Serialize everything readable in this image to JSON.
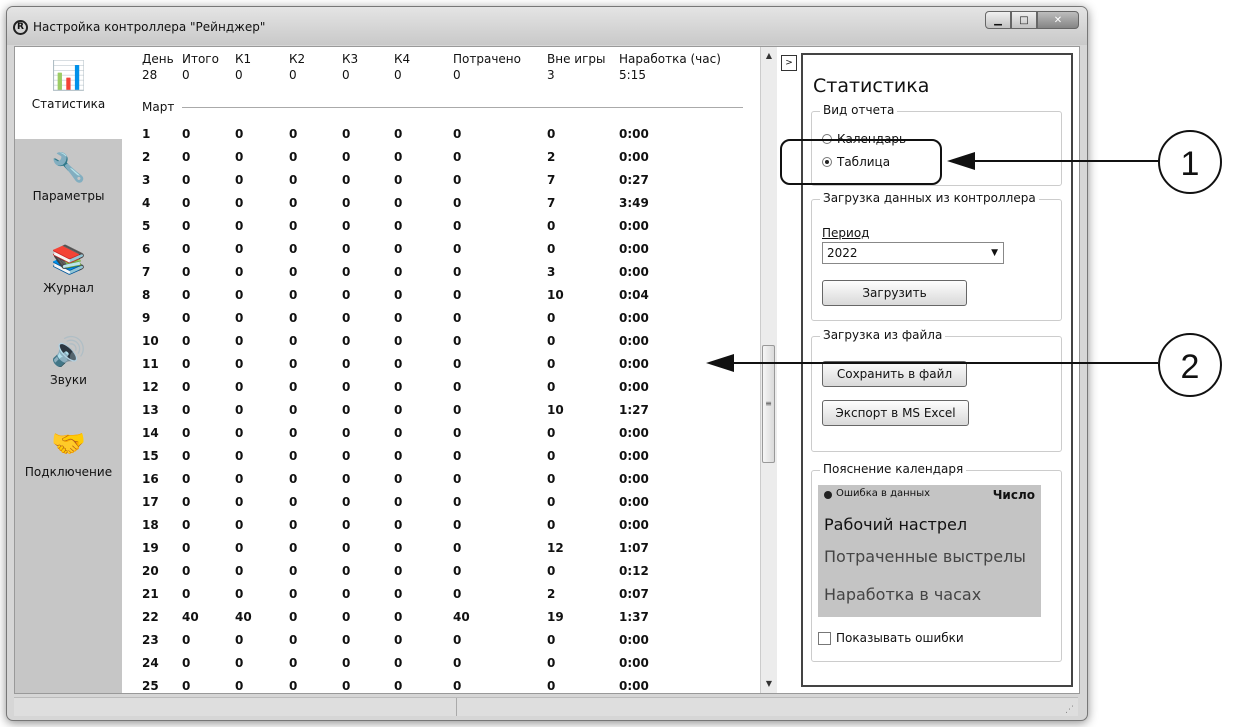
{
  "window": {
    "title": "Настройка контроллера \"Рейнджер\"",
    "app_icon": "R",
    "minimize": "▁",
    "maximize": "□",
    "close": "✕"
  },
  "sidebar": {
    "items": [
      {
        "label": "Статистика",
        "icon": "chart-icon",
        "glyph": "📊"
      },
      {
        "label": "Параметры",
        "icon": "wrench-icon",
        "glyph": "🔧"
      },
      {
        "label": "Журнал",
        "icon": "journal-icon",
        "glyph": "📚"
      },
      {
        "label": "Звуки",
        "icon": "speaker-icon",
        "glyph": "🔊"
      },
      {
        "label": "Подключение",
        "icon": "handshake-icon",
        "glyph": "🤝"
      }
    ]
  },
  "table": {
    "columns": [
      "День",
      "Итого",
      "К1",
      "К2",
      "К3",
      "К4",
      "Потрачено",
      "Вне игры",
      "Наработка (час)"
    ],
    "first_row": [
      "28",
      "0",
      "0",
      "0",
      "0",
      "0",
      "0",
      "3",
      "5:15"
    ],
    "section_label": "Март",
    "rows": [
      [
        "1",
        "0",
        "0",
        "0",
        "0",
        "0",
        "0",
        "0",
        "0:00"
      ],
      [
        "2",
        "0",
        "0",
        "0",
        "0",
        "0",
        "0",
        "2",
        "0:00"
      ],
      [
        "3",
        "0",
        "0",
        "0",
        "0",
        "0",
        "0",
        "7",
        "0:27"
      ],
      [
        "4",
        "0",
        "0",
        "0",
        "0",
        "0",
        "0",
        "7",
        "3:49"
      ],
      [
        "5",
        "0",
        "0",
        "0",
        "0",
        "0",
        "0",
        "0",
        "0:00"
      ],
      [
        "6",
        "0",
        "0",
        "0",
        "0",
        "0",
        "0",
        "0",
        "0:00"
      ],
      [
        "7",
        "0",
        "0",
        "0",
        "0",
        "0",
        "0",
        "3",
        "0:00"
      ],
      [
        "8",
        "0",
        "0",
        "0",
        "0",
        "0",
        "0",
        "10",
        "0:04"
      ],
      [
        "9",
        "0",
        "0",
        "0",
        "0",
        "0",
        "0",
        "0",
        "0:00"
      ],
      [
        "10",
        "0",
        "0",
        "0",
        "0",
        "0",
        "0",
        "0",
        "0:00"
      ],
      [
        "11",
        "0",
        "0",
        "0",
        "0",
        "0",
        "0",
        "0",
        "0:00"
      ],
      [
        "12",
        "0",
        "0",
        "0",
        "0",
        "0",
        "0",
        "0",
        "0:00"
      ],
      [
        "13",
        "0",
        "0",
        "0",
        "0",
        "0",
        "0",
        "10",
        "1:27"
      ],
      [
        "14",
        "0",
        "0",
        "0",
        "0",
        "0",
        "0",
        "0",
        "0:00"
      ],
      [
        "15",
        "0",
        "0",
        "0",
        "0",
        "0",
        "0",
        "0",
        "0:00"
      ],
      [
        "16",
        "0",
        "0",
        "0",
        "0",
        "0",
        "0",
        "0",
        "0:00"
      ],
      [
        "17",
        "0",
        "0",
        "0",
        "0",
        "0",
        "0",
        "0",
        "0:00"
      ],
      [
        "18",
        "0",
        "0",
        "0",
        "0",
        "0",
        "0",
        "0",
        "0:00"
      ],
      [
        "19",
        "0",
        "0",
        "0",
        "0",
        "0",
        "0",
        "12",
        "1:07"
      ],
      [
        "20",
        "0",
        "0",
        "0",
        "0",
        "0",
        "0",
        "0",
        "0:12"
      ],
      [
        "21",
        "0",
        "0",
        "0",
        "0",
        "0",
        "0",
        "2",
        "0:07"
      ],
      [
        "22",
        "40",
        "40",
        "0",
        "0",
        "0",
        "40",
        "19",
        "1:37"
      ],
      [
        "23",
        "0",
        "0",
        "0",
        "0",
        "0",
        "0",
        "0",
        "0:00"
      ],
      [
        "24",
        "0",
        "0",
        "0",
        "0",
        "0",
        "0",
        "0",
        "0:00"
      ],
      [
        "25",
        "0",
        "0",
        "0",
        "0",
        "0",
        "0",
        "0",
        "0:00"
      ]
    ],
    "scroll_up": "▲",
    "scroll_down": "▼",
    "scroll_grip": "≡"
  },
  "panel": {
    "collapse": ">",
    "title": "Статистика",
    "report_group": "Вид отчета",
    "radio_calendar": "Календарь",
    "radio_table": "Таблица",
    "load_group": "Загрузка данных из контроллера",
    "period_label": "Период",
    "period_value": "2022",
    "load_button": "Загрузить",
    "file_group": "Загрузка из файла",
    "save_button": "Сохранить в файл",
    "export_button": "Экспорт в MS Excel",
    "legend_group": "Пояснение календаря",
    "legend_error": "Ошибка в данных",
    "legend_number": "Число",
    "legend_shot": "Рабочий настрел",
    "legend_spent": "Потраченные выстрелы",
    "legend_hours": "Наработка в часах",
    "show_errors": "Показывать ошибки"
  },
  "callouts": {
    "one": "1",
    "two": "2"
  },
  "statusbar": {
    "grip": "⋰"
  }
}
